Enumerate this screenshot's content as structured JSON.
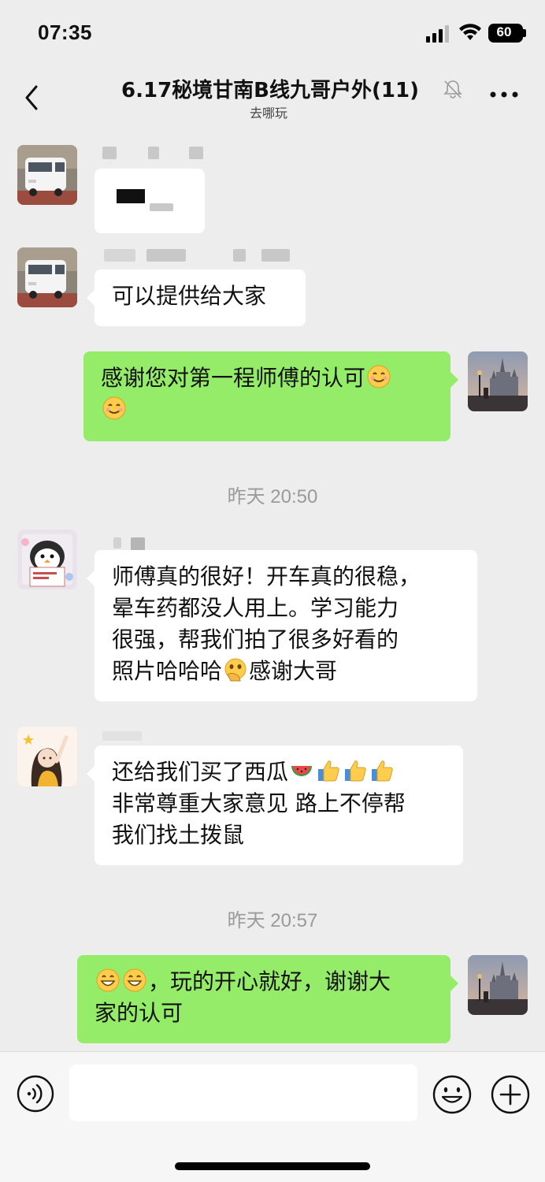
{
  "status_bar": {
    "time": "07:35",
    "battery": "60"
  },
  "header": {
    "title": "6.17秘境甘南B线九哥户外(11)",
    "subtitle": "去哪玩"
  },
  "messages": [
    {
      "text": ""
    },
    {
      "text": "可以提供给大家"
    },
    {
      "text": "感谢您对第一程师傅的认可"
    },
    {
      "text_line1": "师傅真的很好！开车真的很稳，",
      "text_line2": "晕车药都没人用上。学习能力",
      "text_line3": "很强，帮我们拍了很多好看的",
      "text_line4": "照片哈哈哈",
      "text_line4b": "感谢大哥"
    },
    {
      "text_line1": "还给我们买了西瓜",
      "text_line2": "非常尊重大家意见 路上不停帮",
      "text_line3": "我们找土拨鼠"
    },
    {
      "text_line1": "，玩的开心就好，谢谢大",
      "text_line2": "家的认可"
    }
  ],
  "timestamps": [
    "昨天 20:50",
    "昨天 20:57"
  ],
  "icons": {
    "back": "chevron-left-icon",
    "mute": "bell-off-icon",
    "more": "more-dots-icon",
    "voice": "voice-icon",
    "emoji": "emoji-icon",
    "plus": "plus-icon"
  },
  "colors": {
    "outgoing_bubble": "#95ec69",
    "incoming_bubble": "#ffffff",
    "background": "#ededed"
  }
}
